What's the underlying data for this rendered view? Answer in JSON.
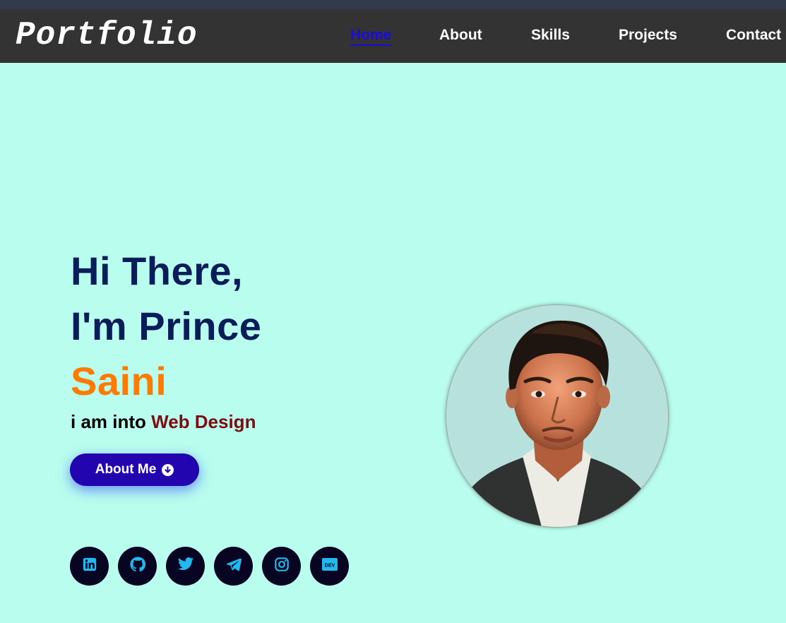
{
  "nav": {
    "brand": "Portfolio",
    "items": [
      {
        "label": "Home",
        "active": true
      },
      {
        "label": "About",
        "active": false
      },
      {
        "label": "Skills",
        "active": false
      },
      {
        "label": "Projects",
        "active": false
      },
      {
        "label": "Contact",
        "active": false
      }
    ]
  },
  "hero": {
    "greeting_line1": "Hi There,",
    "greeting_line2": "I'm Prince",
    "name_accent": "Saini",
    "tagline_prefix": "i am into ",
    "tagline_role": "Web Design",
    "button_label": "About Me",
    "button_icon": "arrow-circle-down-icon"
  },
  "socials": [
    {
      "icon": "linkedin-icon"
    },
    {
      "icon": "github-icon"
    },
    {
      "icon": "twitter-icon"
    },
    {
      "icon": "telegram-icon"
    },
    {
      "icon": "instagram-icon"
    },
    {
      "icon": "dev-icon",
      "text": "DEV"
    }
  ],
  "colors": {
    "background": "#b9fdee",
    "navbar": "#333333",
    "nav_active": "#1a0dd8",
    "headline": "#0a1d58",
    "name_accent": "#ff7a00",
    "role": "#7b0c10",
    "button": "#2305b0",
    "social_bg": "#080522",
    "social_icon": "#22b8f0"
  }
}
